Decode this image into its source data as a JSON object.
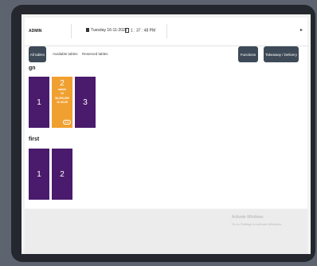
{
  "header": {
    "user": "ADMIN",
    "date": "Tuesday 16-11-2021",
    "time": "1 : 37 : 48 PM",
    "menu_icon": "▸"
  },
  "toolbar": {
    "tabs": [
      "All tables",
      "Available tables",
      "Reserved tables"
    ],
    "functions_label": "Functions",
    "takeaway_label": "Takeaway / Delivery"
  },
  "sections": [
    {
      "title": "gn",
      "tables": [
        {
          "number": "1"
        },
        {
          "number": "2",
          "user": "admin",
          "guests": "10",
          "amount": "56,200,000",
          "time": "11:43:29",
          "badge": "(Inv)"
        },
        {
          "number": "3"
        }
      ]
    },
    {
      "title": "first",
      "tables": [
        {
          "number": "1"
        },
        {
          "number": "2"
        }
      ]
    }
  ],
  "watermark": {
    "title": "Activate Windows",
    "subtitle": "Go to Settings to activate Windows."
  },
  "colors": {
    "table_free": "#4a1a6c",
    "table_occupied": "#f0a030",
    "button": "#3e4a57"
  }
}
